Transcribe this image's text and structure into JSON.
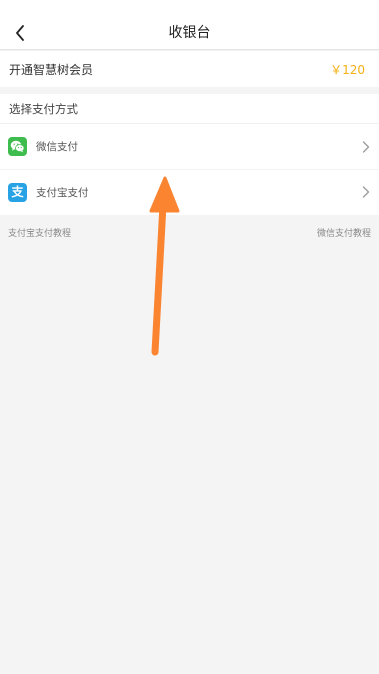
{
  "navbar": {
    "title": "收银台",
    "back_icon": "chevron-left-icon"
  },
  "membership": {
    "label": "开通智慧树会员",
    "price": "￥120",
    "price_color": "#f5b014"
  },
  "payment": {
    "section_title": "选择支付方式",
    "methods": [
      {
        "label": "微信支付",
        "icon": "wechat-icon",
        "color": "#3ebd4e"
      },
      {
        "label": "支付宝支付",
        "icon": "alipay-icon",
        "icon_glyph": "支",
        "color": "#27a2e4"
      }
    ]
  },
  "tutorials": {
    "left": "支付宝支付教程",
    "right": "微信支付教程"
  },
  "overlay": {
    "gesture": "swipe-up-arrow",
    "color": "#fb8431"
  }
}
